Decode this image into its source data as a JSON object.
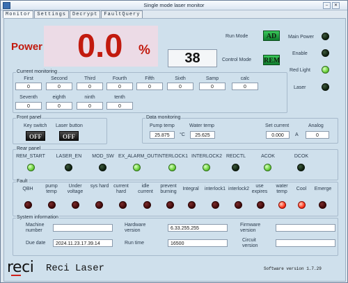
{
  "window": {
    "title": "Single mode laser monitor"
  },
  "tabs": [
    "Monitor",
    "Settings",
    "Decrypt",
    "FaultQuery"
  ],
  "power": {
    "label": "Power",
    "value": "0.0",
    "unit": "%"
  },
  "code_display": "38",
  "modes": {
    "run_mode_label": "Run Mode",
    "run_mode_button": "AD",
    "control_mode_label": "Control Mode",
    "control_mode_button": "REM"
  },
  "status_leds": [
    {
      "label": "Main Power",
      "state": "off"
    },
    {
      "label": "Enable",
      "state": "off"
    },
    {
      "label": "Red Light",
      "state": "on"
    },
    {
      "label": "Laser",
      "state": "off"
    }
  ],
  "current_monitoring": {
    "title": "Current monitoring",
    "row1": [
      {
        "label": "First",
        "value": "0"
      },
      {
        "label": "Second",
        "value": "0"
      },
      {
        "label": "Third",
        "value": "0"
      },
      {
        "label": "Fourth",
        "value": "0"
      },
      {
        "label": "Fifth",
        "value": "0"
      },
      {
        "label": "Sixth",
        "value": "0"
      },
      {
        "label": "Samp",
        "value": "0"
      },
      {
        "label": "calc",
        "value": "0"
      }
    ],
    "row2": [
      {
        "label": "Seventh",
        "value": "0"
      },
      {
        "label": "eighth",
        "value": "0"
      },
      {
        "label": "ninth",
        "value": "0"
      },
      {
        "label": "tenth",
        "value": "0"
      }
    ]
  },
  "front_panel": {
    "title": "Front panel",
    "key_switch_label": "Key switch",
    "key_switch_value": "OFF",
    "laser_button_label": "Laser button",
    "laser_button_value": "OFF"
  },
  "data_monitoring": {
    "title": "Data monitoring",
    "pump_temp_label": "Pump temp",
    "pump_temp_value": "25.875",
    "pump_temp_unit": "°C",
    "water_temp_label": "Water temp",
    "water_temp_value": "25.625",
    "set_current_label": "Set current",
    "set_current_value": "0.000",
    "set_current_unit": "A",
    "analog_label": "Analog",
    "analog_value": "0"
  },
  "rear_panel": {
    "title": "Rear panel",
    "items": [
      {
        "label": "REM_START",
        "state": "on"
      },
      {
        "label": "LASER_EN",
        "state": "off"
      },
      {
        "label": "MOD_SW",
        "state": "off"
      },
      {
        "label": "EX_ALARM_OUT",
        "state": "on"
      },
      {
        "label": "INTERLOCK1",
        "state": "on"
      },
      {
        "label": "INTERLOCK2",
        "state": "on"
      },
      {
        "label": "REDCTL",
        "state": "off"
      },
      {
        "label": "ACOK",
        "state": "on"
      },
      {
        "label": "DCOK",
        "state": "off"
      }
    ]
  },
  "fault": {
    "title": "Fault",
    "items": [
      {
        "label": "QBH",
        "state": "off"
      },
      {
        "label": "pump temp",
        "state": "off"
      },
      {
        "label": "Under voltage",
        "state": "off"
      },
      {
        "label": "sys hard",
        "state": "off"
      },
      {
        "label": "current hard",
        "state": "off"
      },
      {
        "label": "idle current",
        "state": "off"
      },
      {
        "label": "prevent burning",
        "state": "off"
      },
      {
        "label": "Integral",
        "state": "off"
      },
      {
        "label": "interlock1",
        "state": "off"
      },
      {
        "label": "interlock2",
        "state": "off"
      },
      {
        "label": "use expires",
        "state": "off"
      },
      {
        "label": "water temp",
        "state": "on"
      },
      {
        "label": "Cool",
        "state": "on"
      },
      {
        "label": "Emerge",
        "state": "off"
      }
    ]
  },
  "system_information": {
    "title": "System information",
    "machine_number_label": "Machine number",
    "machine_number_value": "",
    "hardware_version_label": "Hardware version",
    "hardware_version_value": "6.33.255.255",
    "firmware_version_label": "Firmware version",
    "firmware_version_value": "",
    "due_date_label": "Due date",
    "due_date_value": "2024.11.23.17.39.14",
    "run_time_label": "Run time",
    "run_time_value": "16500",
    "circuit_version_label": "Circuit version",
    "circuit_version_value": ""
  },
  "footer": {
    "logo": "reci",
    "brand": "Reci Laser",
    "software_version": "Software version  1.7.29"
  },
  "colors": {
    "power_red": "#c21a0e",
    "panel_bg": "#cfe0ec"
  }
}
